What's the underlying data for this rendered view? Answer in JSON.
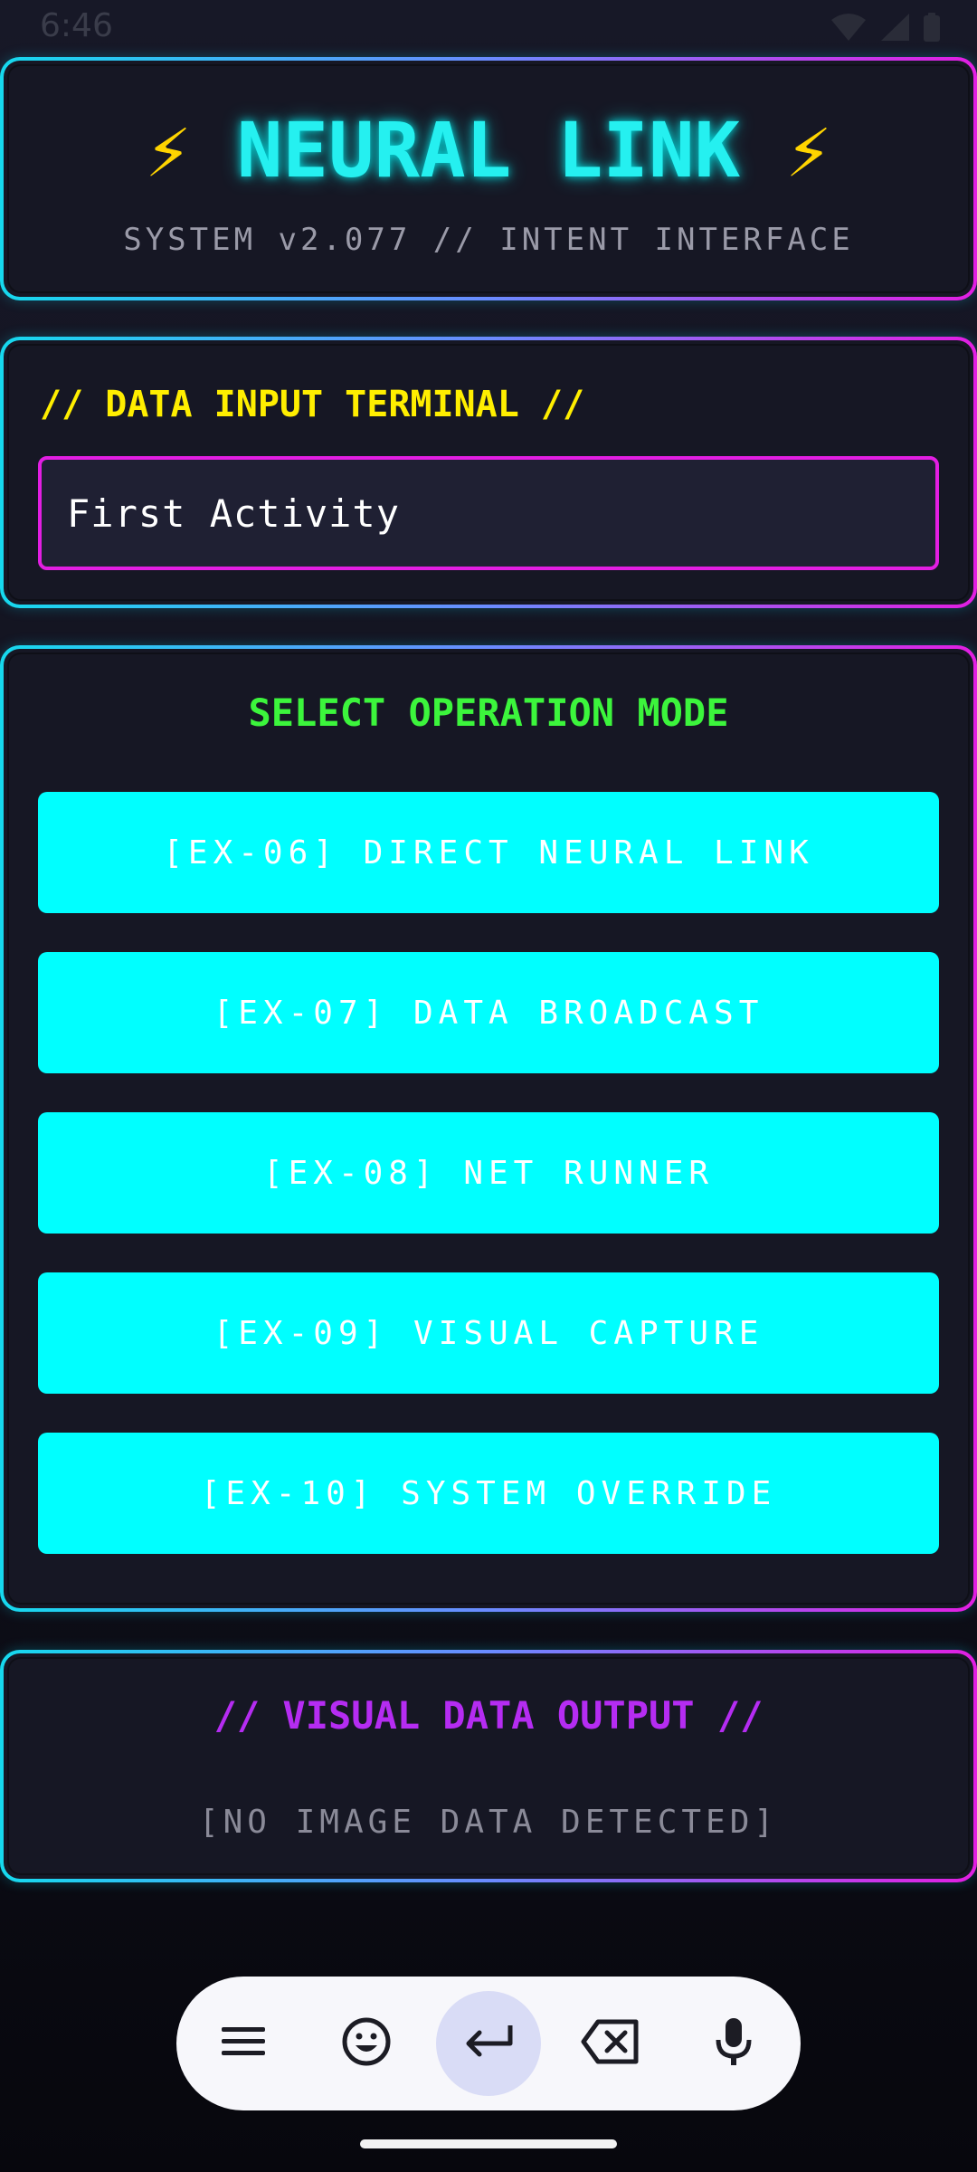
{
  "status_bar": {
    "time": "6:46",
    "icons": [
      "wifi-icon",
      "signal-icon",
      "battery-icon"
    ]
  },
  "header": {
    "bolt_left": "⚡",
    "title": "NEURAL LINK",
    "bolt_right": "⚡",
    "subtitle": "SYSTEM v2.077 // INTENT INTERFACE"
  },
  "input_section": {
    "heading": "// DATA INPUT TERMINAL //",
    "field_value": "First Activity"
  },
  "mode_section": {
    "heading": "SELECT OPERATION MODE",
    "buttons": [
      {
        "label": "[EX-06] DIRECT NEURAL LINK"
      },
      {
        "label": "[EX-07] DATA BROADCAST"
      },
      {
        "label": "[EX-08] NET RUNNER"
      },
      {
        "label": "[EX-09] VISUAL CAPTURE"
      },
      {
        "label": "[EX-10] SYSTEM OVERRIDE"
      }
    ]
  },
  "output_section": {
    "heading": "// VISUAL DATA OUTPUT //",
    "placeholder": "[NO IMAGE DATA DETECTED]"
  },
  "keyboard_toolbar": {
    "keys": [
      "menu-icon",
      "emoji-icon",
      "enter-icon",
      "backspace-icon",
      "mic-icon"
    ],
    "active_key": "enter-icon"
  },
  "colors": {
    "accent_cyan": "#00ffff",
    "accent_magenta": "#e21ee2",
    "heading_yellow": "#ffee00",
    "heading_green": "#3cf53c",
    "heading_purple": "#b52cf2",
    "bolt_yellow": "#ffd400",
    "panel_bg": "#161724"
  }
}
